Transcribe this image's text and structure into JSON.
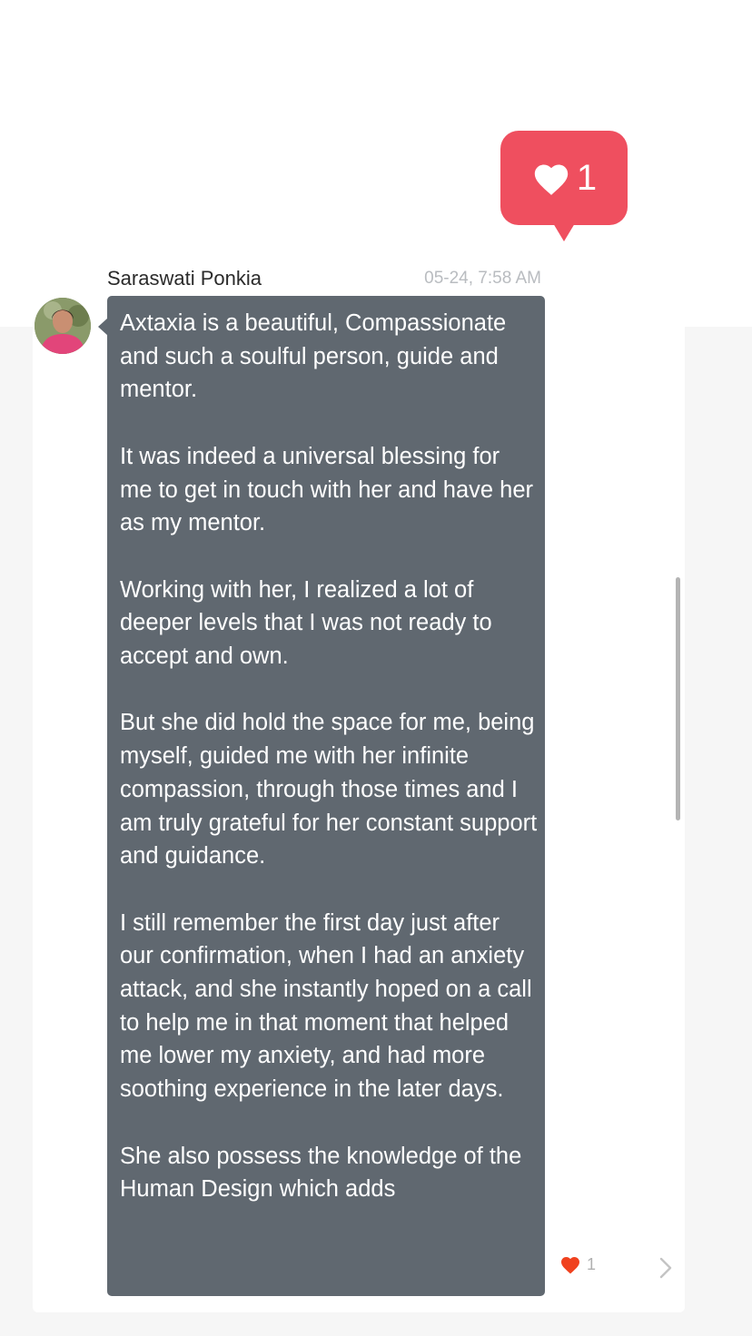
{
  "like_badge": {
    "icon": "heart-icon",
    "count": "1",
    "color": "#ef4f5f"
  },
  "message": {
    "sender": "Saraswati Ponkia",
    "timestamp": "05-24, 7:58 AM",
    "bubble_color": "#606870",
    "text": "Axtaxia is a beautiful, Compassionate and such a soulful person, guide and mentor.\n\nIt was indeed a universal blessing for me to get in touch with her and have her as my mentor.\n\nWorking with her, I realized a lot of deeper levels that I was not ready to accept and own.\n\nBut she did hold the space for me, being myself, guided me with her infinite compassion, through those times and I am truly grateful for her constant support and guidance.\n\nI still remember the first day just after our confirmation, when I had an anxiety attack, and she instantly hoped on a call to help me in that moment that helped me lower my anxiety, and had more soothing experience in the later days.\n\nShe also possess the knowledge of the Human Design which adds"
  },
  "reaction": {
    "icon": "heart-icon",
    "count": "1",
    "color": "#f0421f"
  },
  "nav": {
    "icon": "chevron-right-icon"
  }
}
